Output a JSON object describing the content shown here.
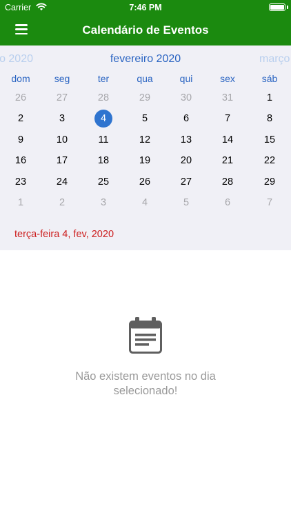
{
  "status_bar": {
    "carrier": "Carrier",
    "time": "7:46 PM"
  },
  "header": {
    "title": "Calendário de Eventos",
    "menu_icon": "hamburger-icon"
  },
  "calendar": {
    "prev_month": "o 2020",
    "current_month": "fevereiro 2020",
    "next_month": "março",
    "weekdays": [
      "dom",
      "seg",
      "ter",
      "qua",
      "qui",
      "sex",
      "sáb"
    ],
    "weeks": [
      [
        "26",
        "27",
        "28",
        "29",
        "30",
        "31",
        "1"
      ],
      [
        "2",
        "3",
        "4",
        "5",
        "6",
        "7",
        "8"
      ],
      [
        "9",
        "10",
        "11",
        "12",
        "13",
        "14",
        "15"
      ],
      [
        "16",
        "17",
        "18",
        "19",
        "20",
        "21",
        "22"
      ],
      [
        "23",
        "24",
        "25",
        "26",
        "27",
        "28",
        "29"
      ],
      [
        "1",
        "2",
        "3",
        "4",
        "5",
        "6",
        "7"
      ]
    ],
    "selected_day": "4",
    "selected_date_label": "terça-feira 4, fev, 2020"
  },
  "empty_state": {
    "icon": "calendar-note-icon",
    "message_line1": "Não existem eventos no dia",
    "message_line2": "selecionado!"
  },
  "colors": {
    "header_bg": "#1b8a0f",
    "accent_blue": "#2a64c2",
    "selected_day_bg": "#2f74cf",
    "selected_date_text": "#cc1d1d"
  }
}
